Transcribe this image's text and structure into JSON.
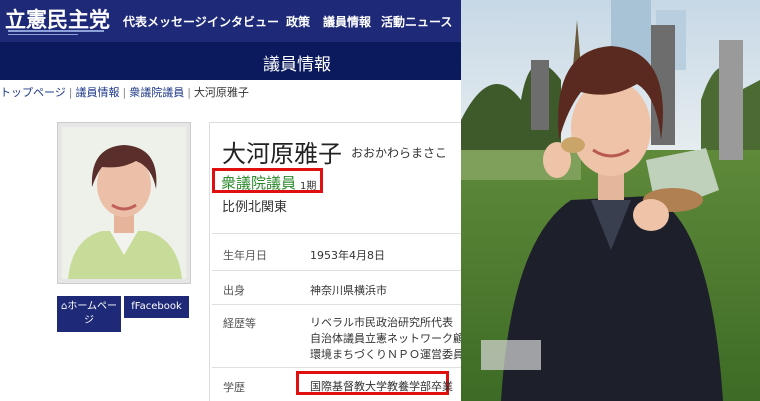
{
  "site": {
    "logo": "立憲民主党",
    "nav": [
      "代表メッセージ",
      "インタビュー",
      "政策",
      "議員情報",
      "活動ニュース"
    ],
    "page_title": "議員情報",
    "breadcrumb": [
      "トップページ",
      "議員情報",
      "衆議院議員",
      "大河原雅子"
    ],
    "buttons": {
      "homepage": "ホームページ",
      "facebook": "Facebook"
    }
  },
  "profile": {
    "name": "大河原雅子",
    "name_kana": "おおかわらまさこ",
    "role": "衆議院議員",
    "term": "1期",
    "district": "比例北関東",
    "rows": [
      {
        "label": "生年月日",
        "value": [
          "1953年4月8日"
        ]
      },
      {
        "label": "出身",
        "value": [
          "神奈川県横浜市"
        ]
      },
      {
        "label": "経歴等",
        "value": [
          "リベラル市民政治研究所代表",
          "自治体議員立憲ネットワーク顧問",
          "環境まちづくりＮＰＯ運営委員"
        ]
      },
      {
        "label": "学歴",
        "value": [
          "国際基督教大学教養学部卒業"
        ]
      }
    ]
  },
  "colors": {
    "nav_bg": "#1e2a78",
    "title_bg": "#0a1a5c",
    "highlight_box": "#e01010",
    "role_text": "#2b8a2b"
  }
}
